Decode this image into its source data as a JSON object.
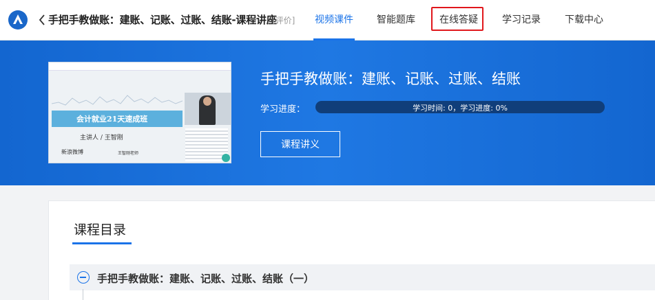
{
  "header": {
    "course_title": "手把手教做账：建账、记账、过账、结账-课程讲座",
    "rate_label": "[评价]",
    "tabs": [
      {
        "label": "视频课件",
        "active": true
      },
      {
        "label": "智能题库",
        "active": false
      },
      {
        "label": "在线答疑",
        "active": false,
        "highlighted": true
      },
      {
        "label": "学习记录",
        "active": false
      },
      {
        "label": "下载中心",
        "active": false
      }
    ],
    "accent_color": "#1a73e8",
    "highlight_color": "#e0161b"
  },
  "banner": {
    "title": "手把手教做账：建账、记账、过账、结账",
    "progress_label": "学习进度：",
    "progress_text": "学习时间: 0，学习进度: 0%",
    "progress_percent": 0,
    "lecture_button": "课程讲义",
    "thumbnail": {
      "band_text": "会计就业21天速成班",
      "presenter": "主讲人 / 王智刚",
      "weibo": "新浪微博",
      "teacher": "王智刚老师"
    }
  },
  "catalog": {
    "title": "课程目录",
    "chapters": [
      {
        "label": "手把手教做账：建账、记账、过账、结账（一）"
      }
    ]
  }
}
